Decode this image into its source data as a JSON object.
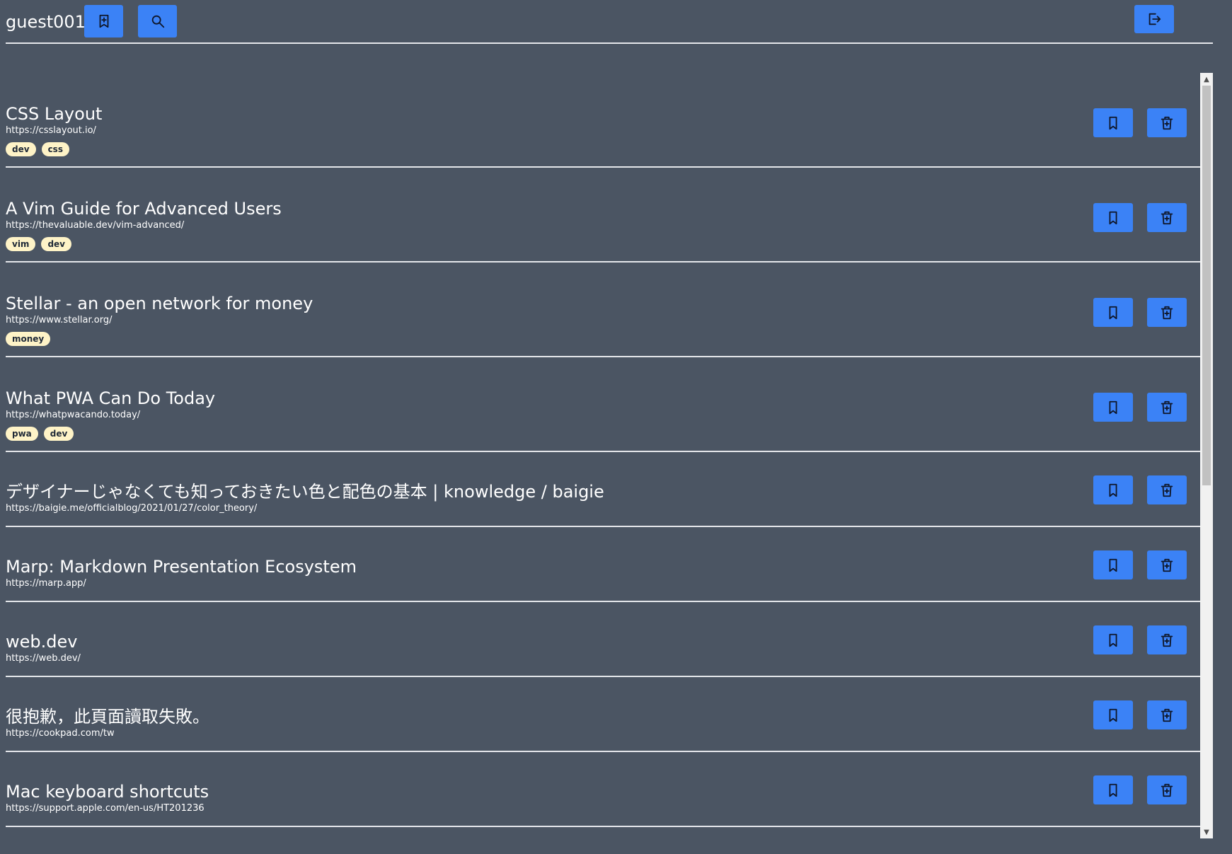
{
  "header": {
    "username": "guest001",
    "add_bookmark_icon": "bookmark-plus-icon",
    "search_icon": "search-icon",
    "logout_icon": "logout-icon"
  },
  "colors": {
    "background": "#4b5563",
    "accent": "#3b82f6",
    "tag_bg": "#fef3c7",
    "divider": "#e5e7eb"
  },
  "bookmarks": [
    {
      "title": "CSS Layout",
      "url": "https://csslayout.io/",
      "tags": [
        "dev",
        "css"
      ]
    },
    {
      "title": "A Vim Guide for Advanced Users",
      "url": "https://thevaluable.dev/vim-advanced/",
      "tags": [
        "vim",
        "dev"
      ]
    },
    {
      "title": "Stellar - an open network for money",
      "url": "https://www.stellar.org/",
      "tags": [
        "money"
      ]
    },
    {
      "title": "What PWA Can Do Today",
      "url": "https://whatpwacando.today/",
      "tags": [
        "pwa",
        "dev"
      ]
    },
    {
      "title": "デザイナーじゃなくても知っておきたい色と配色の基本 | knowledge / baigie",
      "url": "https://baigie.me/officialblog/2021/01/27/color_theory/",
      "tags": []
    },
    {
      "title": "Marp: Markdown Presentation Ecosystem",
      "url": "https://marp.app/",
      "tags": []
    },
    {
      "title": "web.dev",
      "url": "https://web.dev/",
      "tags": []
    },
    {
      "title": "很抱歉，此頁面讀取失敗。",
      "url": "https://cookpad.com/tw",
      "tags": []
    },
    {
      "title": "Mac keyboard shortcuts",
      "url": "https://support.apple.com/en-us/HT201236",
      "tags": []
    }
  ]
}
